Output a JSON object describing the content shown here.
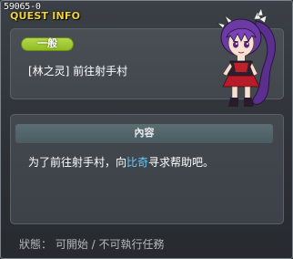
{
  "window": {
    "quest_id": "59065-0",
    "title": "QUEST INFO"
  },
  "quest": {
    "category": "一般",
    "name": "[林之灵] 前往射手村"
  },
  "npc": {
    "icon": "npc-portrait-purple-haired-girl"
  },
  "content": {
    "header": "內容",
    "description_before": "为了前往射手村，向",
    "description_highlight": "比奇",
    "description_after": "寻求帮助吧。"
  },
  "status": {
    "text": "狀態： 可開始 / 不可執行任務"
  },
  "colors": {
    "title": "#f0d23c",
    "badge": "#9cc82e",
    "highlight": "#5fd0ff",
    "status_text": "#b4b8bc"
  }
}
